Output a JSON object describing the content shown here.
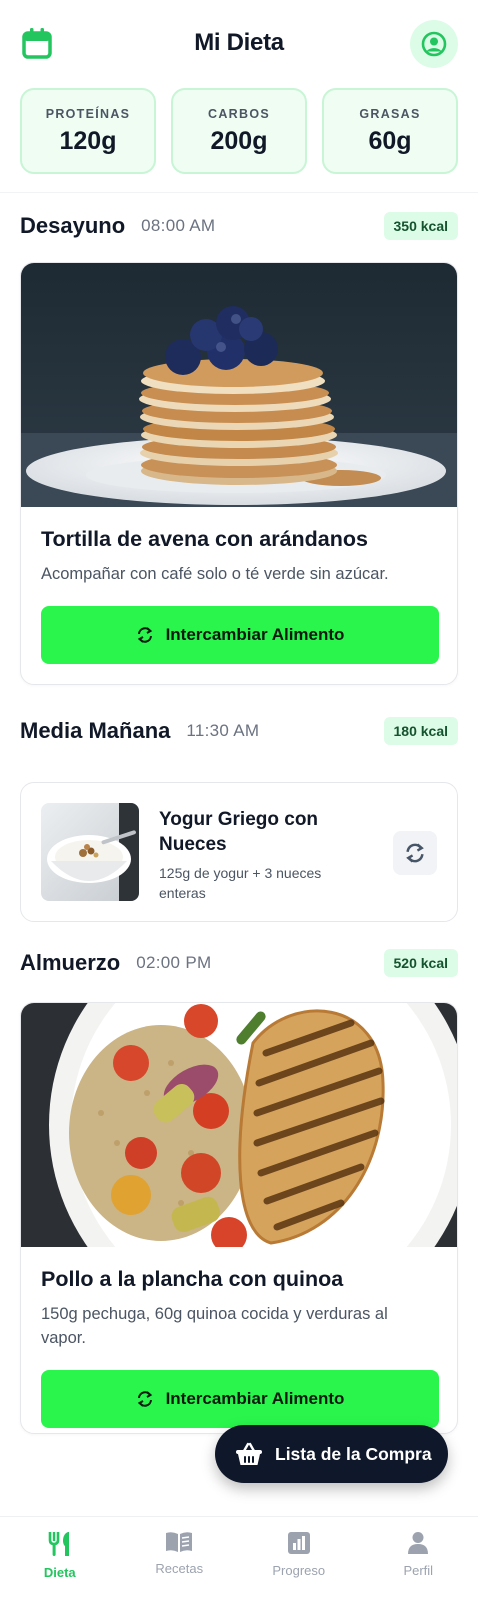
{
  "header": {
    "title": "Mi Dieta",
    "left_icon": "calendar-icon",
    "right_icon": "user-circle-icon"
  },
  "macros": [
    {
      "label": "PROTEÍNAS",
      "value": "120g"
    },
    {
      "label": "CARBOS",
      "value": "200g"
    },
    {
      "label": "GRASAS",
      "value": "60g"
    }
  ],
  "meals": {
    "desayuno": {
      "title": "Desayuno",
      "time": "08:00 AM",
      "kcal": "350 kcal",
      "name": "Tortilla de avena con arándanos",
      "desc": "Acompañar con café solo o té verde sin azúcar.",
      "button": "Intercambiar Alimento"
    },
    "media": {
      "title": "Media Mañana",
      "time": "11:30 AM",
      "kcal": "180 kcal",
      "name": "Yogur Griego con Nueces",
      "desc": "125g de yogur + 3 nueces enteras"
    },
    "almuerzo": {
      "title": "Almuerzo",
      "time": "02:00 PM",
      "kcal": "520 kcal",
      "name": "Pollo a la plancha con quinoa",
      "desc": "150g pechuga, 60g quinoa cocida y verduras al vapor.",
      "button": "Intercambiar Alimento"
    }
  },
  "fab": {
    "label": "Lista de la Compra",
    "icon": "basket-icon"
  },
  "nav": [
    {
      "label": "Dieta",
      "icon": "utensils-icon",
      "active": true
    },
    {
      "label": "Recetas",
      "icon": "book-icon"
    },
    {
      "label": "Progreso",
      "icon": "chart-icon"
    },
    {
      "label": "Perfil",
      "icon": "person-icon"
    }
  ],
  "colors": {
    "accent": "#2af54d",
    "accent_soft": "#dcfce7",
    "dark": "#0f172a"
  }
}
